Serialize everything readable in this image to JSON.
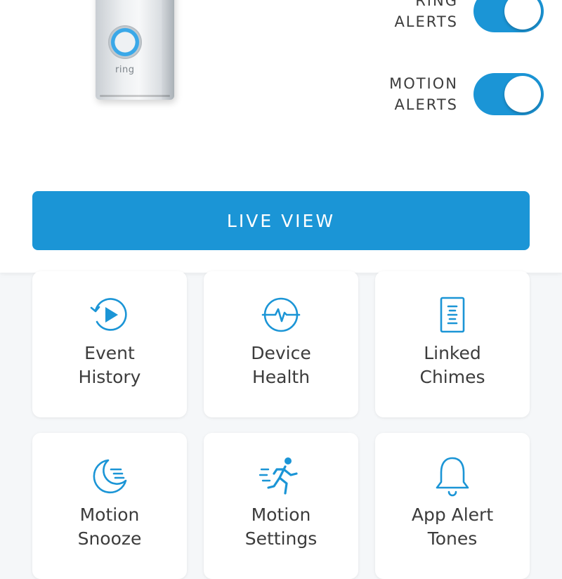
{
  "device": {
    "brand": "ring"
  },
  "toggles": {
    "ring_alerts": {
      "label_line1": "RING",
      "label_line2": "ALERTS",
      "on": true
    },
    "motion_alerts": {
      "label_line1": "MOTION",
      "label_line2": "ALERTS",
      "on": true
    }
  },
  "live_view": {
    "label": "LIVE VIEW"
  },
  "tiles": [
    {
      "label": "Event\nHistory",
      "icon": "event-history-icon"
    },
    {
      "label": "Device\nHealth",
      "icon": "device-health-icon"
    },
    {
      "label": "Linked\nChimes",
      "icon": "linked-chimes-icon"
    },
    {
      "label": "Motion\nSnooze",
      "icon": "motion-snooze-icon"
    },
    {
      "label": "Motion\nSettings",
      "icon": "motion-settings-icon"
    },
    {
      "label": "App Alert\nTones",
      "icon": "app-alert-tones-icon"
    }
  ],
  "colors": {
    "accent": "#1b95d6",
    "text": "#3c3c3c",
    "background": "#f5f7f9"
  }
}
